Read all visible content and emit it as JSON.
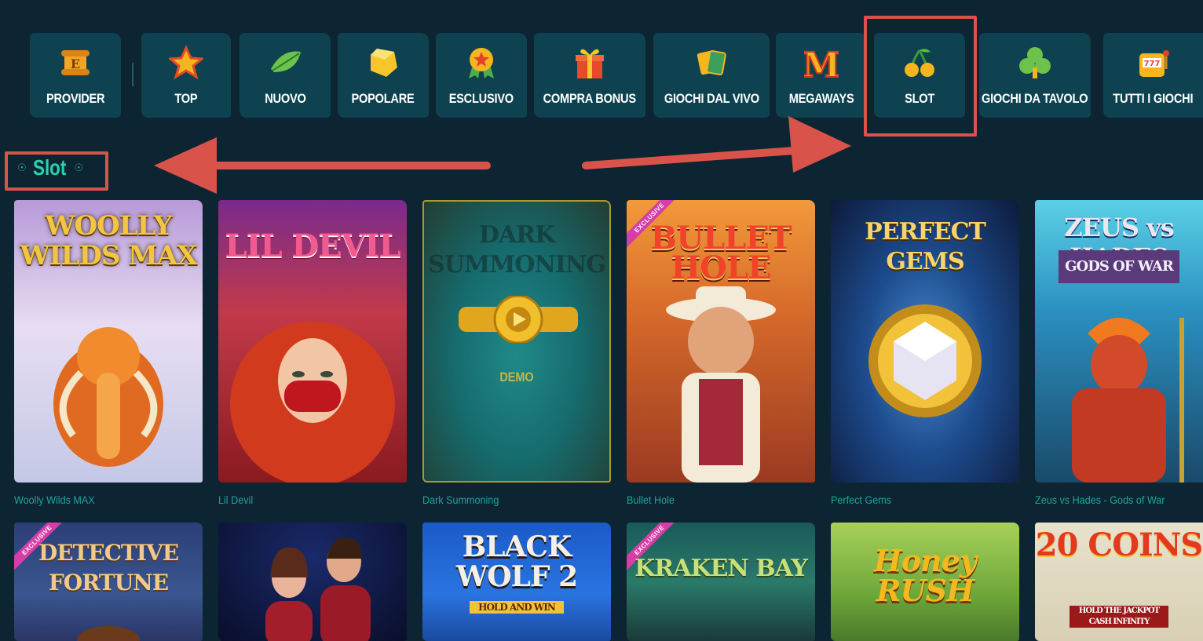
{
  "categories": [
    {
      "label": "PROVIDER",
      "icon": "scroll-icon"
    },
    {
      "label": "TOP",
      "icon": "star-icon"
    },
    {
      "label": "NUOVO",
      "icon": "leaf-icon"
    },
    {
      "label": "POPOLARE",
      "icon": "gem-icon"
    },
    {
      "label": "ESCLUSIVO",
      "icon": "medal-icon"
    },
    {
      "label": "COMPRA BONUS",
      "icon": "gift-icon"
    },
    {
      "label": "GIOCHI DAL VIVO",
      "icon": "cards-icon"
    },
    {
      "label": "MEGAWAYS",
      "icon": "megaways-m-icon"
    },
    {
      "label": "SLOT",
      "icon": "cherries-icon"
    },
    {
      "label": "GIOCHI DA TAVOLO",
      "icon": "clover-icon"
    },
    {
      "label": "TUTTI I GIOCHI",
      "icon": "slot-machine-icon"
    }
  ],
  "selected_category": "SLOT",
  "section": {
    "title": "Slot"
  },
  "games_row1": [
    {
      "name": "Woolly Wilds MAX",
      "logo": "WOOLLY WILDS MAX"
    },
    {
      "name": "Lil Devil",
      "logo": "LIL DEVIL"
    },
    {
      "name": "Dark Summoning",
      "logo": "DARK SUMMONING",
      "demo_label": "DEMO"
    },
    {
      "name": "Bullet Hole",
      "logo": "BULLET HOLE",
      "badge": "EXCLUSIVE"
    },
    {
      "name": "Perfect Gems",
      "logo": "PERFECT GEMS"
    },
    {
      "name": "Zeus vs Hades - Gods of War",
      "logo": "ZEUS vs HADES",
      "sublogo": "GODS OF WAR"
    }
  ],
  "games_row2": [
    {
      "logo": "DETECTIVE FORTUNE",
      "badge": "EXCLUSIVE"
    },
    {
      "logo": ""
    },
    {
      "logo": "BLACK WOLF 2",
      "sublogo": "HOLD AND WIN"
    },
    {
      "logo": "KRAKEN BAY",
      "badge": "EXCLUSIVE"
    },
    {
      "logo": "Honey RUSH"
    },
    {
      "logo": "20 COINS",
      "sublogo": "HOLD THE JACKPOT CASH INFINITY"
    }
  ],
  "colors": {
    "background": "#0d2532",
    "tab": "#0f4250",
    "accent": "#26d3b2",
    "annotation": "#d9534a"
  }
}
